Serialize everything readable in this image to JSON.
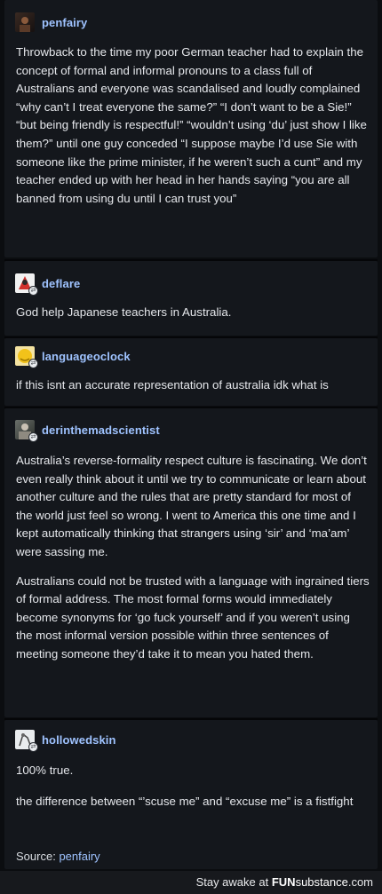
{
  "colors": {
    "background": "#0b0d10",
    "card": "#14171c",
    "username": "#9fc3ff",
    "text": "#e6e8ec"
  },
  "posts": [
    {
      "username": "penfairy",
      "avatar_icon": "dark-portrait-avatar-icon",
      "paragraphs": [
        "Throwback to the time my poor German teacher had to explain the concept of formal and informal pronouns to a class full of Australians and everyone was scandalised and loudly complained “why can’t I treat everyone the same?” “I don’t want to be a Sie!” “but being friendly is respectful!” “wouldn’t using ‘du’ just show I like them?” until one guy conceded “I suppose maybe I’d use Sie with someone like the prime minister, if he weren’t such a cunt” and my teacher ended up with her head in her hands saying “you are all banned from using du until I can trust you”"
      ]
    },
    {
      "username": "deflare",
      "avatar_icon": "red-figure-avatar-icon",
      "paragraphs": [
        "God help Japanese teachers in Australia."
      ]
    },
    {
      "username": "languageoclock",
      "avatar_icon": "yellow-sun-avatar-icon",
      "paragraphs": [
        "if this isnt an accurate representation of australia idk what is"
      ]
    },
    {
      "username": "derinthemadscientist",
      "avatar_icon": "scientist-avatar-icon",
      "paragraphs": [
        "Australia’s reverse-formality respect culture is fascinating. We don’t even really think about it until we try to communicate or learn about another culture and the rules that are pretty standard for most of the world just feel so wrong. I went to America this one time and I kept automatically thinking that strangers using ‘sir’ and ‘ma’am’ were sassing me.",
        "Australians could not be trusted with a language with ingrained tiers of formal address. The most formal forms would immediately become synonyms for ‘go fuck yourself’ and if you weren’t using the most informal version possible within three sentences of meeting someone they’d take it to mean you hated them."
      ]
    },
    {
      "username": "hollowedskin",
      "avatar_icon": "sketch-avatar-icon",
      "paragraphs": [
        "100% true.",
        "the difference between “’scuse me” and “excuse me” is a fistfight"
      ]
    }
  ],
  "source": {
    "label": "Source:",
    "link": "penfairy"
  },
  "footer": {
    "slogan": "Stay awake at",
    "brand_a": "FUN",
    "brand_b": "substance",
    "tld": ".com"
  }
}
